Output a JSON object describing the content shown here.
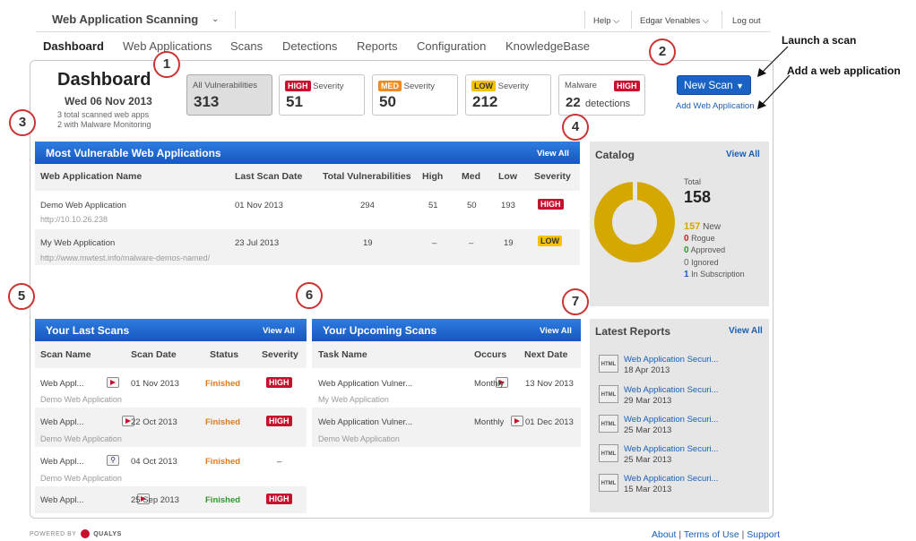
{
  "header": {
    "app_name": "Web Application Scanning",
    "help": "Help",
    "user": "Edgar Venables",
    "logout": "Log out"
  },
  "nav": [
    "Dashboard",
    "Web Applications",
    "Scans",
    "Detections",
    "Reports",
    "Configuration",
    "KnowledgeBase"
  ],
  "dashboard": {
    "title": "Dashboard",
    "date": "Wed 06 Nov 2013",
    "sub1": "3 total scanned web apps",
    "sub2": "2 with Malware Monitoring"
  },
  "stats": {
    "all_label": "All Vulnerabilities",
    "all_value": "313",
    "high_badge": "HIGH",
    "high_label": "Severity",
    "high_value": "51",
    "med_badge": "MED",
    "med_label": "Severity",
    "med_value": "50",
    "low_badge": "LOW",
    "low_label": "Severity",
    "low_value": "212",
    "malware_label": "Malware",
    "malware_badge": "HIGH",
    "malware_value": "22",
    "malware_unit": "detections"
  },
  "actions": {
    "new_scan": "New Scan",
    "add_web": "Add Web Application"
  },
  "annotations": {
    "launch": "Launch a scan",
    "add": "Add a web application",
    "c1": "1",
    "c2": "2",
    "c3": "3",
    "c4": "4",
    "c5": "5",
    "c6": "6",
    "c7": "7"
  },
  "vuln_apps": {
    "title": "Most Vulnerable Web Applications",
    "view_all": "View All",
    "headers": [
      "Web Application Name",
      "Last Scan Date",
      "Total Vulnerabilities",
      "High",
      "Med",
      "Low",
      "Severity"
    ],
    "rows": [
      {
        "name": "Demo Web Application",
        "url": "http://10.10.26.238",
        "date": "01 Nov 2013",
        "total": "294",
        "high": "51",
        "med": "50",
        "low": "193",
        "severity": "HIGH"
      },
      {
        "name": "My Web Application",
        "url": "http://www.mwtest.info/malware-demos-named/",
        "date": "23 Jul 2013",
        "total": "19",
        "high": "–",
        "med": "–",
        "low": "19",
        "severity": "LOW"
      }
    ]
  },
  "catalog": {
    "title": "Catalog",
    "view_all": "View All",
    "total_label": "Total",
    "total": "158",
    "new_count": "157",
    "new_label": "New",
    "rogue_count": "0",
    "rogue_label": "Rogue",
    "approved_count": "0",
    "approved_label": "Approved",
    "ignored_count": "0",
    "ignored_label": "Ignored",
    "subs_count": "1",
    "subs_label": "In Subscription",
    "colors": {
      "new": "#d4a800",
      "rogue": "#cc2222",
      "approved": "#2a9a2a",
      "ignored": "#666666",
      "subscription": "#1a5fb4"
    }
  },
  "last_scans": {
    "title": "Your Last Scans",
    "view_all": "View All",
    "headers": [
      "Scan Name",
      "Scan Date",
      "Status",
      "Severity"
    ],
    "rows": [
      {
        "name": "Web Appl...",
        "app": "Demo Web Application",
        "date": "01 Nov 2013",
        "status": "Finished",
        "severity": "HIGH",
        "icon": "scan-icon"
      },
      {
        "name": "Web Appl...",
        "app": "Demo Web Application",
        "date": "22 Oct 2013",
        "status": "Finished",
        "severity": "HIGH",
        "icon": "scan-icon"
      },
      {
        "name": "Web Appl...",
        "app": "Demo Web Application",
        "date": "04 Oct 2013",
        "status": "Finished",
        "severity": "–",
        "icon": "discovery-icon"
      },
      {
        "name": "Web Appl...",
        "app": "",
        "date": "25 Sep 2013",
        "status": "Finished",
        "severity": "HIGH",
        "icon": "scan-icon"
      }
    ]
  },
  "upcoming_scans": {
    "title": "Your Upcoming Scans",
    "view_all": "View All",
    "headers": [
      "Task Name",
      "Occurs",
      "Next Date"
    ],
    "rows": [
      {
        "name": "Web Application Vulner...",
        "app": "My Web Application",
        "occurs": "Monthly",
        "next": "13 Nov 2013"
      },
      {
        "name": "Web Application Vulner...",
        "app": "Demo Web Application",
        "occurs": "Monthly",
        "next": "01 Dec 2013"
      }
    ]
  },
  "reports": {
    "title": "Latest Reports",
    "view_all": "View All",
    "icon_text": "HTML",
    "items": [
      {
        "name": "Web Application Securi...",
        "date": "18 Apr 2013"
      },
      {
        "name": "Web Application Securi...",
        "date": "29 Mar 2013"
      },
      {
        "name": "Web Application Securi...",
        "date": "25 Mar 2013"
      },
      {
        "name": "Web Application Securi...",
        "date": "25 Mar 2013"
      },
      {
        "name": "Web Application Securi...",
        "date": "15 Mar 2013"
      }
    ]
  },
  "footer": {
    "powered": "POWERED BY",
    "brand": "QUALYS",
    "about": "About",
    "terms": "Terms of Use",
    "support": "Support"
  }
}
